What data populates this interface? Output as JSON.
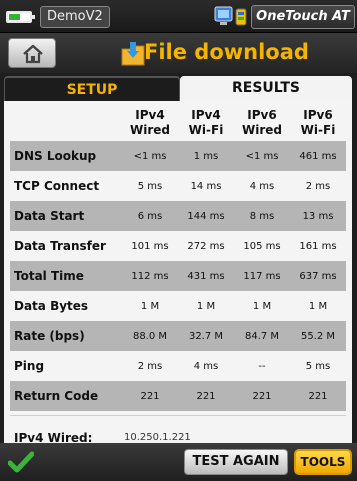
{
  "statusbar": {
    "device_name": "DemoV2",
    "app_name": "OneTouch AT",
    "battery_level": 0.55,
    "battery_color": "#2fb52f",
    "network_icon": "network-status-icon"
  },
  "titlebar": {
    "home_icon": "home-icon",
    "page_icon": "folder-download-icon",
    "title": "File download",
    "title_color": "#f5b400"
  },
  "tabs": [
    {
      "label": "SETUP",
      "active": false
    },
    {
      "label": "RESULTS",
      "active": true
    }
  ],
  "table": {
    "columns": [
      {
        "line1": "IPv4",
        "line2": "Wired"
      },
      {
        "line1": "IPv4",
        "line2": "Wi-Fi"
      },
      {
        "line1": "IPv6",
        "line2": "Wired"
      },
      {
        "line1": "IPv6",
        "line2": "Wi-Fi"
      }
    ],
    "rows": [
      {
        "label": "DNS Lookup",
        "values": [
          "<1 ms",
          "1 ms",
          "<1 ms",
          "461 ms"
        ]
      },
      {
        "label": "TCP Connect",
        "values": [
          "5 ms",
          "14 ms",
          "4 ms",
          "2 ms"
        ]
      },
      {
        "label": "Data Start",
        "values": [
          "6 ms",
          "144 ms",
          "8 ms",
          "13 ms"
        ]
      },
      {
        "label": "Data Transfer",
        "values": [
          "101 ms",
          "272 ms",
          "105 ms",
          "161 ms"
        ]
      },
      {
        "label": "Total Time",
        "values": [
          "112 ms",
          "431 ms",
          "117 ms",
          "637 ms"
        ]
      },
      {
        "label": "Data Bytes",
        "values": [
          "1 M",
          "1 M",
          "1 M",
          "1 M"
        ]
      },
      {
        "label": "Rate (bps)",
        "values": [
          "88.0 M",
          "32.7 M",
          "84.7 M",
          "55.2 M"
        ]
      },
      {
        "label": "Ping",
        "values": [
          "2 ms",
          "4 ms",
          "--",
          "5 ms"
        ]
      },
      {
        "label": "Return Code",
        "values": [
          "221",
          "221",
          "221",
          "221"
        ]
      }
    ]
  },
  "detail": {
    "label": "IPv4 Wired:",
    "value": "10.250.1.221"
  },
  "bottombar": {
    "status_icon": "checkmark-icon",
    "test_again_label": "TEST AGAIN",
    "tools_label": "TOOLS"
  }
}
